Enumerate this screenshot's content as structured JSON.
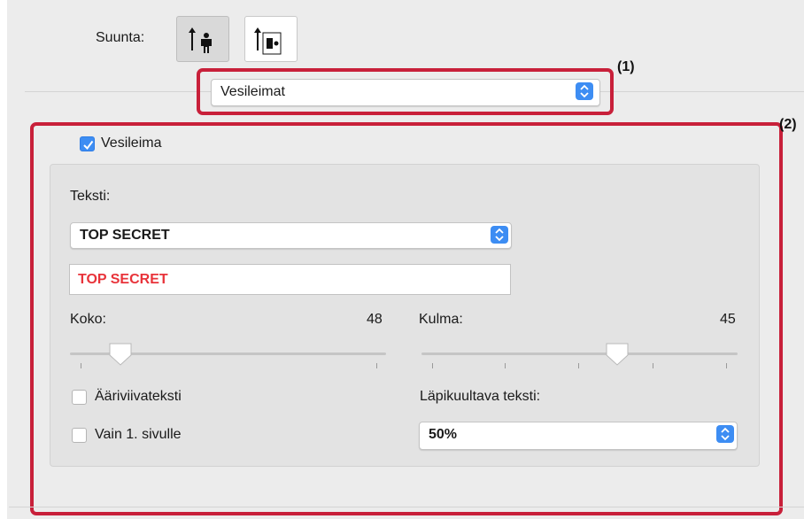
{
  "orientation": {
    "label": "Suunta:",
    "options": [
      {
        "icon": "portrait-orientation-icon",
        "selected": true
      },
      {
        "icon": "landscape-orientation-icon",
        "selected": false
      }
    ]
  },
  "panel_select": {
    "value": "Vesileimat",
    "callout": "(1)"
  },
  "watermark": {
    "callout": "(2)",
    "enable_label": "Vesileima",
    "enabled": true,
    "text_label": "Teksti:",
    "text_preset": "TOP SECRET",
    "text_value": "TOP SECRET",
    "text_color": "#e8333a",
    "size_label": "Koko:",
    "size_value": "48",
    "size_fraction": 0.16,
    "angle_label": "Kulma:",
    "angle_value": "45",
    "angle_fraction": 0.62,
    "outline_label": "Ääriviivateksti",
    "outline_checked": false,
    "first_page_label": "Vain 1. sivulle",
    "first_page_checked": false,
    "transparency_label": "Läpikuultava teksti:",
    "transparency_value": "50%"
  },
  "colors": {
    "accent": "#3d8df3",
    "callout": "#c8203a"
  }
}
